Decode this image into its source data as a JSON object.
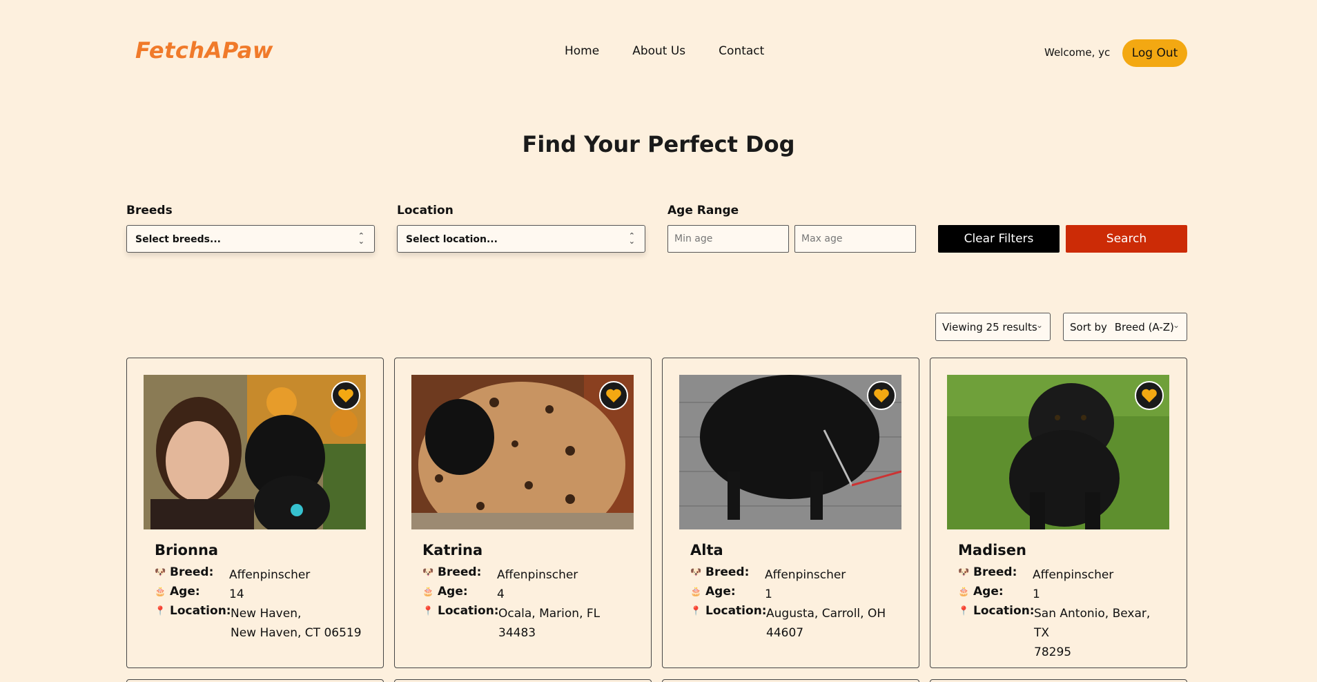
{
  "header": {
    "logo": "FetchAPaw",
    "nav": [
      "Home",
      "About Us",
      "Contact"
    ],
    "welcome": "Welcome, yc",
    "logout": "Log Out"
  },
  "main": {
    "title": "Find Your Perfect Dog",
    "filters": {
      "breeds_label": "Breeds",
      "breeds_placeholder": "Select breeds...",
      "location_label": "Location",
      "location_placeholder": "Select location...",
      "age_label": "Age Range",
      "min_placeholder": "Min age",
      "max_placeholder": "Max age",
      "clear": "Clear Filters",
      "search": "Search"
    },
    "results": {
      "viewing": "Viewing 25 results",
      "sort_prefix": "Sort by",
      "sort_value": "Breed (A-Z)"
    },
    "labels": {
      "breed": "Breed:",
      "age": "Age:",
      "location": "Location:"
    },
    "dogs": [
      {
        "name": "Brionna",
        "breed": "Affenpinscher",
        "age": "14",
        "location_1": "New Haven,",
        "location_2": "New Haven, CT 06519"
      },
      {
        "name": "Katrina",
        "breed": "Affenpinscher",
        "age": "4",
        "location_1": "Ocala, Marion, FL",
        "location_2": "34483"
      },
      {
        "name": "Alta",
        "breed": "Affenpinscher",
        "age": "1",
        "location_1": "Augusta, Carroll, OH",
        "location_2": "44607"
      },
      {
        "name": "Madisen",
        "breed": "Affenpinscher",
        "age": "1",
        "location_1": "San Antonio, Bexar, TX",
        "location_2": "78295"
      }
    ]
  },
  "colors": {
    "background": "#fdf0de",
    "logo": "#f07a2a",
    "accent": "#f3a812",
    "search": "#cc2b06"
  }
}
